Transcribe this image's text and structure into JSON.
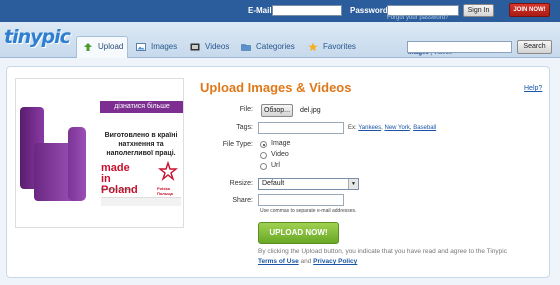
{
  "topbar": {
    "email_label": "E-Mail:",
    "password_label": "Password:",
    "forgot_link": "Forgot your password?",
    "signin_button": "Sign In",
    "join_button": "JOIN NOW!"
  },
  "header": {
    "logo": "tinypic",
    "tabs": [
      {
        "label": "Upload",
        "icon": "upload-arrow-icon",
        "active": true
      },
      {
        "label": "Images",
        "icon": "images-icon",
        "active": false
      },
      {
        "label": "Videos",
        "icon": "film-icon",
        "active": false
      },
      {
        "label": "Categories",
        "icon": "folder-icon",
        "active": false
      },
      {
        "label": "Favorites",
        "icon": "star-icon",
        "active": false
      }
    ],
    "search_toggle": {
      "images": "Images",
      "separator": " | ",
      "videos": "Videos"
    },
    "search_button": "Search"
  },
  "ad": {
    "banner": "дізнатися більше",
    "slogan": "Виготовлено в країні натхнення та наполегливої праці.",
    "made": "made in Poland",
    "made_sub": "Виготовлено в Польщі",
    "brand": "Polska",
    "brand_sub": "Польща"
  },
  "form": {
    "title": "Upload Images & Videos",
    "help": "Help?",
    "file_label": "File:",
    "browse_button": "Обзор...",
    "file_name": "del.jpg",
    "tags_label": "Tags:",
    "tags_value": "",
    "tags_hint_prefix": "Ex: ",
    "tags_examples": [
      "Yankees",
      "New York",
      "Baseball"
    ],
    "file_type_label": "File Type:",
    "file_types": [
      "Image",
      "Video",
      "Url"
    ],
    "file_type_selected": "Image",
    "resize_label": "Resize:",
    "resize_value": "Default",
    "share_label": "Share:",
    "share_value": "",
    "share_note": "Use commas to separate e-mail addresses.",
    "upload_button": "UPLOAD NOW!",
    "agree_text": "By clicking the Upload button, you indicate that you have read and agree to the Tinypic",
    "terms_link": "Terms of Use",
    "and_text": " and ",
    "privacy_link": "Privacy Policy"
  },
  "colors": {
    "topbar": "#2b5c9c",
    "accent_orange": "#e0781a",
    "link_blue": "#1a55a5",
    "upload_green": "#7ab83a",
    "join_red": "#c0261d"
  }
}
